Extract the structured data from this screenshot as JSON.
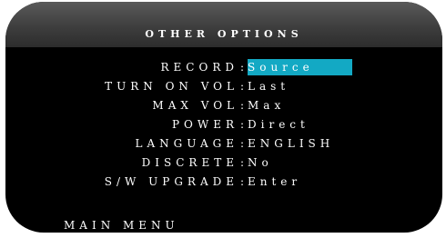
{
  "title": "OTHER OPTIONS",
  "menu": {
    "items": [
      {
        "label": "RECORD",
        "value": "Source",
        "selected": true
      },
      {
        "label": "TURN ON VOL",
        "value": "Last",
        "selected": false
      },
      {
        "label": "MAX VOL",
        "value": "Max",
        "selected": false
      },
      {
        "label": "POWER",
        "value": "Direct",
        "selected": false
      },
      {
        "label": "LANGUAGE",
        "value": "ENGLISH",
        "selected": false
      },
      {
        "label": "DISCRETE",
        "value": "No",
        "selected": false
      },
      {
        "label": "S/W UPGRADE",
        "value": "Enter",
        "selected": false
      }
    ],
    "separator": ":"
  },
  "footer": {
    "main_menu": "MAIN MENU"
  },
  "colors": {
    "highlight": "#13a9c4",
    "background": "#000000",
    "text": "#ffffff"
  }
}
